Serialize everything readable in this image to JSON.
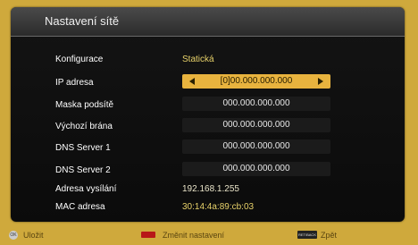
{
  "window": {
    "title": "Nastavení sítě"
  },
  "rows": {
    "config": {
      "label": "Konfigurace",
      "value": "Statická"
    },
    "ip": {
      "label": "IP adresa",
      "value": "[0]00.000.000.000"
    },
    "mask": {
      "label": "Maska podsítě",
      "value": "000.000.000.000"
    },
    "gateway": {
      "label": "Výchozí brána",
      "value": "000.000.000.000"
    },
    "dns1": {
      "label": "DNS Server 1",
      "value": "000.000.000.000"
    },
    "dns2": {
      "label": "DNS Server 2",
      "value": "000.000.000.000"
    },
    "broadcast": {
      "label": "Adresa vysílání",
      "value": "192.168.1.255"
    },
    "mac": {
      "label": "MAC adresa",
      "value": "30:14:4a:89:cb:03"
    }
  },
  "footer": {
    "ok_key": "OK",
    "save_label": "Uložit",
    "change_label": "Změnit nastavení",
    "back_key": "RET/BACK",
    "back_label": "Zpět"
  },
  "colors": {
    "accent_gold": "#e8b33e",
    "value_yellow": "#e8d26a",
    "frame": "#cfa93c"
  }
}
